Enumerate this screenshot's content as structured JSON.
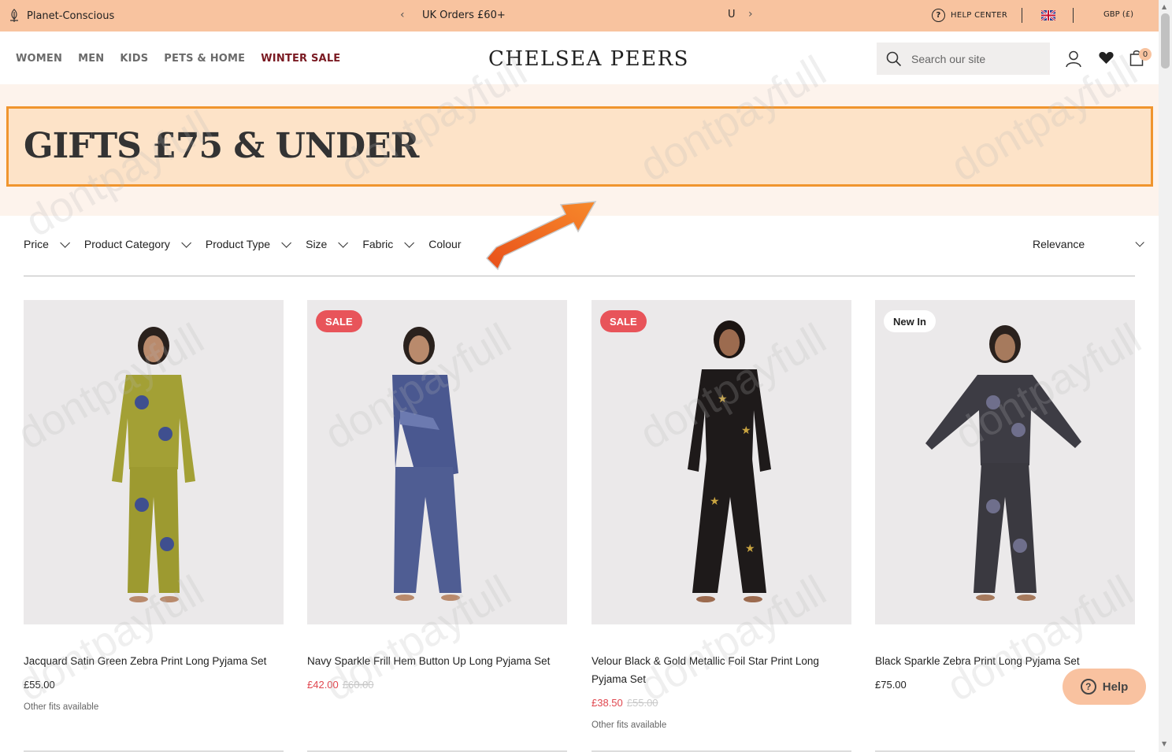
{
  "topbar": {
    "planet_label": "Planet-Conscious",
    "promo_text": "UK Orders £60+",
    "promo_tail": "U",
    "help_label": "HELP CENTER",
    "currency": "GBP (£)"
  },
  "nav": {
    "items": [
      "WOMEN",
      "MEN",
      "KIDS",
      "PETS & HOME",
      "WINTER SALE"
    ]
  },
  "brand": {
    "logo": "CHELSEA PEERS"
  },
  "search": {
    "placeholder": "Search our site"
  },
  "cart": {
    "count": "0"
  },
  "hero": {
    "title": "GIFTS £75 & UNDER"
  },
  "filters": {
    "items": [
      "Price",
      "Product Category",
      "Product Type",
      "Size",
      "Fabric",
      "Colour"
    ],
    "sort_label": "Relevance"
  },
  "arrow_label": "dontpayfull",
  "watermark": "dontpayfull",
  "products": [
    {
      "badge": "",
      "name": "Jacquard Satin Green Zebra Print Long Pyjama Set",
      "price": "£55.00",
      "was": "",
      "fits": "Other fits available",
      "colors": {
        "top": "#a3a035",
        "bottom": "#9d9a30",
        "print": "#3f4f8f"
      }
    },
    {
      "badge": "SALE",
      "name": "Navy Sparkle Frill Hem Button Up Long Pyjama Set",
      "price": "£42.00",
      "was": "£60.00",
      "fits": "",
      "colors": {
        "top": "#4a5890",
        "bottom": "#4f5d93",
        "print": "#6c7ab0"
      }
    },
    {
      "badge": "SALE",
      "name": "Velour Black & Gold Metallic Foil Star Print Long Pyjama Set",
      "price": "£38.50",
      "was": "£55.00",
      "fits": "Other fits available",
      "colors": {
        "top": "#1e1a1a",
        "bottom": "#1e1a1a",
        "print": "#c9a440"
      }
    },
    {
      "badge": "New In",
      "name": "Black Sparkle Zebra Print Long Pyjama Set",
      "price": "£75.00",
      "was": "",
      "fits": "",
      "colors": {
        "top": "#3d3c44",
        "bottom": "#3a3940",
        "print": "#6f6f8c"
      }
    }
  ],
  "help_button": {
    "label": "Help"
  }
}
